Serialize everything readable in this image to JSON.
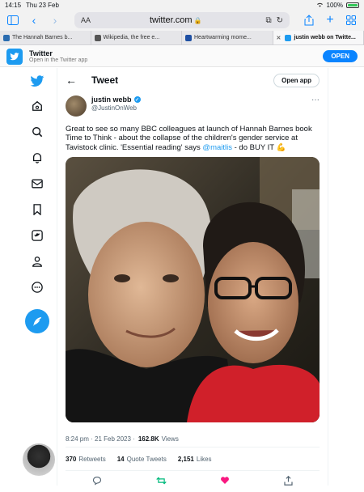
{
  "status_bar": {
    "time": "14:15",
    "date": "Thu 23 Feb",
    "battery": "100%"
  },
  "browser": {
    "aa_label": "AA",
    "url": "twitter.com",
    "tabs": [
      {
        "label": "The Hannah Barnes b...",
        "active": false,
        "favicon_color": "#2a6cb0"
      },
      {
        "label": "Wikipedia, the free e...",
        "active": false,
        "favicon_color": "#555555"
      },
      {
        "label": "Heartwarming mome...",
        "active": false,
        "favicon_color": "#1e4fa3"
      },
      {
        "label": "justin webb on Twitte...",
        "active": true,
        "favicon_color": "#1d9bf0"
      }
    ]
  },
  "app_banner": {
    "title": "Twitter",
    "subtitle": "Open in the Twitter app",
    "open_label": "OPEN"
  },
  "header": {
    "title": "Tweet",
    "open_app_label": "Open app"
  },
  "tweet": {
    "author_name": "justin webb",
    "author_handle": "@JustinOnWeb",
    "text_before": "Great to see so many BBC colleagues at launch of Hannah Barnes book Time to Think - about the collapse of the children's gender service at Tavistock clinic.  'Essential reading' says ",
    "mention": "@maitlis",
    "text_after": " - do BUY IT 💪",
    "timestamp": "8:24 pm · 21 Feb 2023 ·",
    "views_count": "162.8K",
    "views_label": "Views",
    "retweets_count": "370",
    "retweets_label": "Retweets",
    "quotes_count": "14",
    "quotes_label": "Quote Tweets",
    "likes_count": "2,151",
    "likes_label": "Likes"
  },
  "colors": {
    "twitter_blue": "#1d9bf0",
    "safari_blue": "#0a84ff",
    "like_pink": "#f91880",
    "retweet_green": "#00ba7c"
  }
}
